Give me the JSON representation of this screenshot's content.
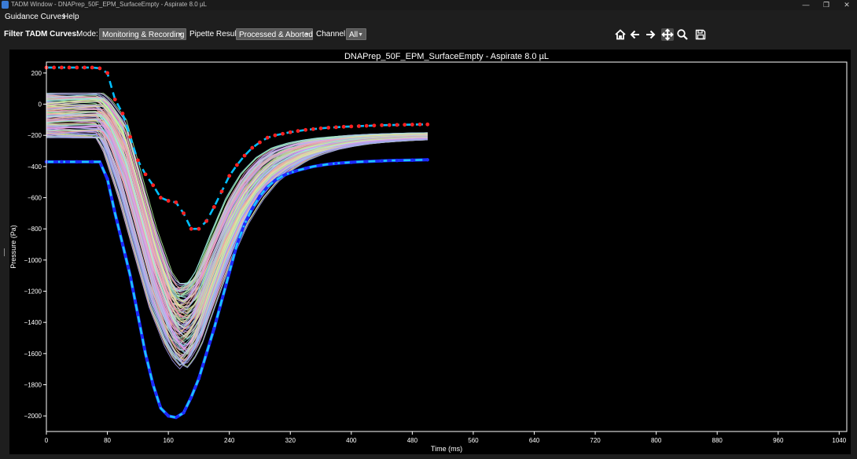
{
  "window": {
    "title": "TADM Window - DNAPrep_50F_EPM_SurfaceEmpty - Aspirate 8.0 µL",
    "app_icon": "tadm-app-icon",
    "controls": [
      "minimize",
      "restore",
      "close"
    ]
  },
  "menu": {
    "items": [
      "Guidance Curves",
      "Help"
    ]
  },
  "filter": {
    "label": "Filter TADM Curves:",
    "mode_label": "Mode:",
    "mode_value": "Monitoring & Recording",
    "pipette_label": "Pipette Result:",
    "pipette_value": "Processed & Aborted",
    "channel_label": "Channel:",
    "channel_value": "All"
  },
  "toolbar": {
    "icons": [
      "home-icon",
      "back-arrow-icon",
      "forward-arrow-icon",
      "pan-icon",
      "zoom-icon",
      "save-icon"
    ],
    "active": "pan-icon"
  },
  "colors": {
    "background": "#1e1e1e",
    "plot_background": "#000000",
    "upper_guidance": "#00bfff",
    "upper_markers": "#ff2020",
    "lower_guidance": "#1c2bff",
    "lower_dash": "#19c8ff"
  },
  "chart_data": {
    "type": "line",
    "title": "DNAPrep_50F_EPM_SurfaceEmpty - Aspirate 8.0 µL",
    "xlabel": "Time (ms)",
    "ylabel": "Pressure (Pa)",
    "xlim": [
      0,
      1050
    ],
    "ylim": [
      -2100,
      270
    ],
    "xticks": [
      0,
      80,
      160,
      240,
      320,
      400,
      480,
      560,
      640,
      720,
      800,
      880,
      960,
      1040
    ],
    "yticks": [
      200,
      0,
      -200,
      -400,
      -600,
      -800,
      -1000,
      -1200,
      -1400,
      -1600,
      -1800,
      -2000
    ],
    "grid": false,
    "legend": "none",
    "series": [
      {
        "role": "upper guidance curve",
        "x": [
          0,
          10,
          20,
          30,
          40,
          50,
          60,
          70,
          80,
          90,
          100,
          110,
          120,
          130,
          140,
          150,
          160,
          170,
          180,
          190,
          200,
          210,
          220,
          230,
          240,
          250,
          260,
          270,
          280,
          290,
          300,
          310,
          320,
          330,
          340,
          350,
          360,
          370,
          380,
          390,
          400,
          410,
          420,
          430,
          440,
          450,
          460,
          470,
          480,
          490,
          500
        ],
        "y": [
          235,
          235,
          235,
          235,
          235,
          235,
          235,
          230,
          200,
          30,
          -60,
          -210,
          -360,
          -450,
          -520,
          -600,
          -620,
          -630,
          -700,
          -800,
          -800,
          -750,
          -660,
          -560,
          -460,
          -390,
          -330,
          -280,
          -245,
          -215,
          -200,
          -190,
          -180,
          -172,
          -165,
          -160,
          -155,
          -151,
          -148,
          -145,
          -143,
          -141,
          -139,
          -137,
          -135,
          -134,
          -133,
          -132,
          -131,
          -130,
          -130
        ]
      },
      {
        "role": "lower guidance curve",
        "x": [
          0,
          10,
          20,
          30,
          40,
          50,
          60,
          70,
          80,
          90,
          100,
          110,
          120,
          130,
          140,
          150,
          160,
          170,
          180,
          190,
          200,
          210,
          220,
          230,
          240,
          250,
          260,
          270,
          280,
          290,
          300,
          310,
          320,
          330,
          340,
          350,
          360,
          370,
          380,
          390,
          400,
          410,
          420,
          430,
          440,
          450,
          460,
          470,
          480,
          490,
          500
        ],
        "y": [
          -370,
          -370,
          -370,
          -370,
          -370,
          -370,
          -370,
          -370,
          -480,
          -700,
          -900,
          -1100,
          -1350,
          -1600,
          -1800,
          -1950,
          -2000,
          -2010,
          -1980,
          -1880,
          -1760,
          -1600,
          -1440,
          -1260,
          -1080,
          -900,
          -770,
          -670,
          -590,
          -530,
          -490,
          -460,
          -440,
          -425,
          -412,
          -400,
          -392,
          -385,
          -380,
          -376,
          -373,
          -370,
          -368,
          -366,
          -364,
          -362,
          -361,
          -360,
          -359,
          -358,
          -357
        ]
      },
      {
        "role": "recorded TADM curves envelope",
        "count": 120,
        "x": [
          0,
          70,
          80,
          100,
          120,
          140,
          160,
          170,
          180,
          190,
          200,
          220,
          240,
          260,
          280,
          300,
          320,
          340,
          360,
          380,
          400,
          420,
          440,
          460,
          480,
          500
        ],
        "y_max": [
          70,
          70,
          30,
          -100,
          -450,
          -800,
          -1080,
          -1150,
          -1150,
          -1120,
          -1050,
          -820,
          -600,
          -440,
          -340,
          -280,
          -250,
          -230,
          -215,
          -205,
          -198,
          -193,
          -190,
          -187,
          -185,
          -183
        ],
        "y_min": [
          -215,
          -215,
          -300,
          -600,
          -950,
          -1300,
          -1550,
          -1640,
          -1700,
          -1640,
          -1550,
          -1270,
          -1000,
          -780,
          -620,
          -500,
          -420,
          -360,
          -320,
          -290,
          -270,
          -255,
          -245,
          -238,
          -232,
          -228
        ]
      }
    ]
  }
}
